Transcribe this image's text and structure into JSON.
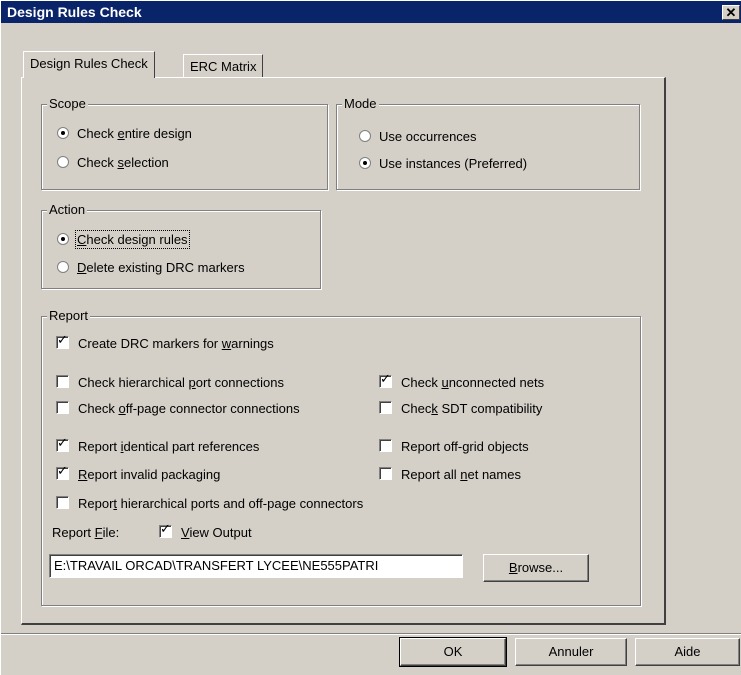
{
  "window": {
    "title": "Design Rules Check",
    "close_glyph": "✕"
  },
  "tabs": [
    {
      "label": "Design Rules Check",
      "active": true
    },
    {
      "label": "ERC Matrix",
      "active": false
    }
  ],
  "scope": {
    "legend": "Scope",
    "options": [
      {
        "pre": "Check ",
        "mnemonic": "e",
        "post": "ntire design",
        "selected": true
      },
      {
        "pre": "Check ",
        "mnemonic": "s",
        "post": "election",
        "selected": false
      }
    ]
  },
  "mode": {
    "legend": "Mode",
    "options": [
      {
        "label": "Use occurrences",
        "selected": false
      },
      {
        "label": "Use instances (Preferred)",
        "selected": true
      }
    ]
  },
  "action": {
    "legend": "Action",
    "options": [
      {
        "pre": "",
        "mnemonic": "C",
        "post": "heck design rules",
        "selected": true
      },
      {
        "pre": "",
        "mnemonic": "D",
        "post": "elete existing DRC markers",
        "selected": false
      }
    ]
  },
  "report": {
    "legend": "Report",
    "create_drc_markers": {
      "pre": "Create DRC markers for ",
      "mnemonic": "w",
      "post": "arnings",
      "checked": true
    },
    "check_hier_port": {
      "pre": "Check hierarchical ",
      "mnemonic": "p",
      "post": "ort connections",
      "checked": false
    },
    "check_unconnected": {
      "pre": "Check ",
      "mnemonic": "u",
      "post": "nconnected nets",
      "checked": true
    },
    "check_offpage": {
      "pre": "Check ",
      "mnemonic": "o",
      "post": "ff-page connector connections",
      "checked": false
    },
    "check_sdt": {
      "pre": "Chec",
      "mnemonic": "k",
      "post": " SDT compatibility",
      "checked": false
    },
    "report_identical": {
      "pre": "Report ",
      "mnemonic": "i",
      "post": "dentical part references",
      "checked": true
    },
    "report_offgrid": {
      "pre": "Report off-",
      "mnemonic": "g",
      "post": "rid objects",
      "checked": false
    },
    "report_invalid_pkg": {
      "pre": "",
      "mnemonic": "R",
      "post": "eport invalid packaging",
      "checked": true
    },
    "report_net_names": {
      "pre": "Report all ",
      "mnemonic": "n",
      "post": "et names",
      "checked": false
    },
    "report_hier_ports": {
      "pre": "Repor",
      "mnemonic": "t",
      "post": " hierarchical ports and off-page connectors",
      "checked": false
    },
    "report_file": {
      "pre": "Report ",
      "mnemonic": "F",
      "post": "ile:"
    },
    "view_output": {
      "pre": "",
      "mnemonic": "V",
      "post": "iew Output",
      "checked": true
    },
    "file_path": "E:\\TRAVAIL ORCAD\\TRANSFERT LYCEE\\NE555PATRI",
    "browse": {
      "pre": "",
      "mnemonic": "B",
      "post": "rowse..."
    }
  },
  "buttons": {
    "ok": "OK",
    "cancel": "Annuler",
    "help": "Aide"
  }
}
